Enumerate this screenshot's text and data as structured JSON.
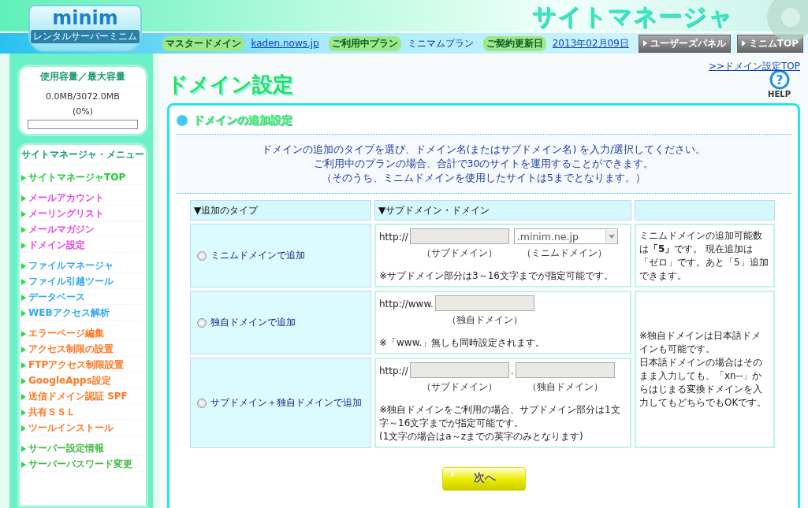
{
  "header": {
    "logo": "minim",
    "logo_sub": "レンタルサーバーミニム",
    "title": "サイトマネージャ",
    "info": [
      {
        "label": "マスタードメイン",
        "value": "kaden.nows.jp",
        "kind": "link"
      },
      {
        "label": "ご利用中プラン",
        "value": "ミニマムプラン",
        "kind": "text"
      },
      {
        "label": "ご契約更新日",
        "value": "2013年02月09日",
        "kind": "link"
      }
    ],
    "buttons": [
      "ユーザーズパネル",
      "ミニムTOP"
    ]
  },
  "sidebar": {
    "usage": {
      "title": "使用容量／最大容量",
      "value": "0.0MB/3072.0MB",
      "percent": "(0%)",
      "level": 0
    },
    "menu_title": "サイトマネージャ・メニュー",
    "groups": [
      [
        {
          "label": "サイトマネージャTOP",
          "color": "#22cc33"
        }
      ],
      [
        {
          "label": "メールアカウント",
          "color": "#ee44dd"
        },
        {
          "label": "メーリングリスト",
          "color": "#ee44dd"
        },
        {
          "label": "メールマガジン",
          "color": "#ee44dd"
        },
        {
          "label": "ドメイン設定",
          "color": "#ee44dd"
        }
      ],
      [
        {
          "label": "ファイルマネージャ",
          "color": "#33aaee"
        },
        {
          "label": "ファイル引越ツール",
          "color": "#33aaee"
        },
        {
          "label": "データベース",
          "color": "#33aaee"
        },
        {
          "label": "WEBアクセス解析",
          "color": "#33aaee"
        }
      ],
      [
        {
          "label": "エラーページ編集",
          "color": "#ff7722"
        },
        {
          "label": "アクセス制限の設置",
          "color": "#ff7722"
        },
        {
          "label": "FTPアクセス制限設置",
          "color": "#ff7722"
        },
        {
          "label": "GoogleApps設定",
          "color": "#ff7722"
        },
        {
          "label": "送信ドメイン認証 SPF",
          "color": "#ff7722"
        },
        {
          "label": "共有ＳＳＬ",
          "color": "#ff7722"
        },
        {
          "label": "ツールインストール",
          "color": "#ff7722"
        }
      ],
      [
        {
          "label": "サーバー設定情報",
          "color": "#44bb44"
        },
        {
          "label": "サーバーパスワード変更",
          "color": "#44bb44"
        }
      ]
    ]
  },
  "main": {
    "top_link": ">>ドメイン設定TOP",
    "page_title": "ドメイン設定",
    "help_label": "HELP",
    "help_icon": "?",
    "section_title": "ドメインの追加設定",
    "intro": [
      "ドメインの追加のタイプを選び、ドメイン名(またはサブドメイン名) を入力/選択してください。",
      "ご利用中のプランの場合、合計で30のサイトを運用することができます。",
      "（そのうち、ミニムドメインを使用したサイトは5までとなります。）"
    ],
    "table": {
      "columns": [
        "▼追加のタイプ",
        "▼サブドメイン・ドメイン"
      ],
      "rows": [
        {
          "type": "ミニムドメインで追加",
          "selected": false,
          "fields": [
            {
              "kind": "prefix",
              "text": "http://"
            },
            {
              "kind": "input",
              "caption": "（サブドメイン）"
            },
            {
              "kind": "select",
              "value": ".minim.ne.jp",
              "caption": "（ミニムドメイン）"
            }
          ],
          "notes": [
            "※サブドメイン部分は3～16文字までが指定可能です。"
          ],
          "side_note": [
            "ミニムドメインの追加可能数は**「5」**です。 現在追加は「ゼロ」です。あと「5」追加できます。"
          ]
        },
        {
          "type": "独自ドメインで追加",
          "selected": false,
          "fields": [
            {
              "kind": "prefix",
              "text": "http://www."
            },
            {
              "kind": "input",
              "caption": "（独自ドメイン）"
            }
          ],
          "notes": [
            "※「www.」無しも同時設定されます。"
          ],
          "side_note": [
            "※独自ドメインは日本語ドメインも可能です。",
            "日本語ドメインの場合はそのまま入力しても、「xn--」からはじまる変換ドメインを入力してもどちらでもOKです。"
          ]
        },
        {
          "type": "サブドメイン＋独自ドメインで追加",
          "selected": false,
          "fields": [
            {
              "kind": "prefix",
              "text": "http://"
            },
            {
              "kind": "input",
              "caption": "（サブドメイン）"
            },
            {
              "kind": "prefix",
              "text": "."
            },
            {
              "kind": "input",
              "caption": "（独自ドメイン）"
            }
          ],
          "notes": [
            "※独自ドメインをご利用の場合、サブドメイン部分は1文字～16文字までが指定可能です。",
            "(1文字の場合はa～zまでの英字のみとなります)"
          ]
        }
      ]
    },
    "next_button": "次へ"
  }
}
